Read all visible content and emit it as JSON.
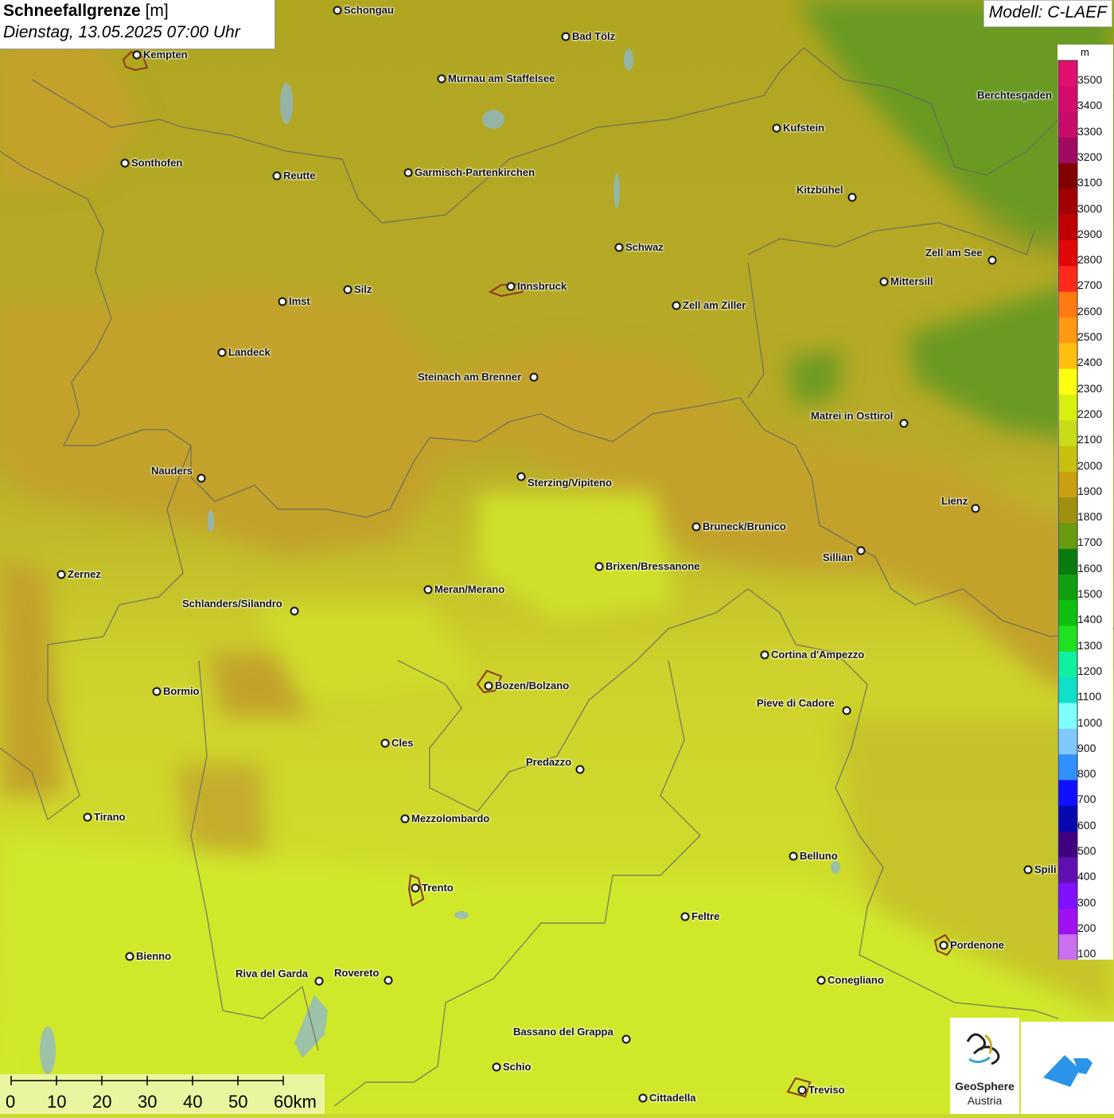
{
  "title": {
    "main": "Schneefallgrenze",
    "unit": "[m]",
    "datetime": "Dienstag, 13.05.2025 07:00 Uhr"
  },
  "model": "Modell: C-LAEF",
  "legend": {
    "unit": "m",
    "levels": [
      "3500",
      "3400",
      "3300",
      "3200",
      "3100",
      "3000",
      "2900",
      "2800",
      "2700",
      "2600",
      "2500",
      "2400",
      "2300",
      "2200",
      "2100",
      "2000",
      "1900",
      "1800",
      "1700",
      "1600",
      "1500",
      "1400",
      "1300",
      "1200",
      "1100",
      "1000",
      "900",
      "800",
      "700",
      "600",
      "500",
      "400",
      "300",
      "200",
      "100"
    ],
    "colors": [
      "#e0106e",
      "#d50c70",
      "#c80c6c",
      "#a00a62",
      "#800000",
      "#a00000",
      "#c00000",
      "#e00808",
      "#ff2a1a",
      "#ff7a10",
      "#ff9a10",
      "#ffc010",
      "#ffff10",
      "#d8f010",
      "#c8dc18",
      "#c8c010",
      "#c8a010",
      "#a09010",
      "#6a9a10",
      "#0a7a10",
      "#10a010",
      "#10c010",
      "#20e020",
      "#10f0a0",
      "#10e0c8",
      "#80ffff",
      "#80c8ff",
      "#3090ff",
      "#1010ff",
      "#0808b0",
      "#400080",
      "#6010b0",
      "#8010ff",
      "#a010f0",
      "#c870f0"
    ]
  },
  "cities": [
    {
      "name": "Schongau"
    },
    {
      "name": "Bad Tölz"
    },
    {
      "name": "Kempten"
    },
    {
      "name": "Murnau am Staffelsee"
    },
    {
      "name": "Berchtesgaden"
    },
    {
      "name": "Kufstein"
    },
    {
      "name": "Sonthofen"
    },
    {
      "name": "Reutte"
    },
    {
      "name": "Garmisch-Partenkirchen"
    },
    {
      "name": "Kitzbühel"
    },
    {
      "name": "Schwaz"
    },
    {
      "name": "Zell am See"
    },
    {
      "name": "Imst"
    },
    {
      "name": "Silz"
    },
    {
      "name": "Innsbruck"
    },
    {
      "name": "Zell am Ziller"
    },
    {
      "name": "Mittersill"
    },
    {
      "name": "Landeck"
    },
    {
      "name": "Steinach am Brenner"
    },
    {
      "name": "Matrei in Osttirol"
    },
    {
      "name": "Nauders"
    },
    {
      "name": "Sterzing/Vipiteno"
    },
    {
      "name": "Lienz"
    },
    {
      "name": "Bruneck/Brunico"
    },
    {
      "name": "Sillian"
    },
    {
      "name": "Zernez"
    },
    {
      "name": "Brixen/Bressanone"
    },
    {
      "name": "Meran/Merano"
    },
    {
      "name": "Schlanders/Silandro"
    },
    {
      "name": "Cortina d'Ampezzo"
    },
    {
      "name": "Bormio"
    },
    {
      "name": "Bozen/Bolzano"
    },
    {
      "name": "Pieve di Cadore"
    },
    {
      "name": "Cles"
    },
    {
      "name": "Predazzo"
    },
    {
      "name": "Tirano"
    },
    {
      "name": "Mezzolombardo"
    },
    {
      "name": "Belluno"
    },
    {
      "name": "Spili"
    },
    {
      "name": "Trento"
    },
    {
      "name": "Feltre"
    },
    {
      "name": "Pordenone"
    },
    {
      "name": "Bienno"
    },
    {
      "name": "Riva del Garda"
    },
    {
      "name": "Rovereto"
    },
    {
      "name": "Conegliano"
    },
    {
      "name": "Bassano del Grappa"
    },
    {
      "name": "Schio"
    },
    {
      "name": "Treviso"
    },
    {
      "name": "Cittadella"
    }
  ],
  "scale_bar": {
    "labels": [
      "0",
      "10",
      "20",
      "30",
      "40",
      "50",
      "60km"
    ]
  },
  "logo": {
    "name_line1": "GeoSphere",
    "name_line2": "Austria"
  }
}
